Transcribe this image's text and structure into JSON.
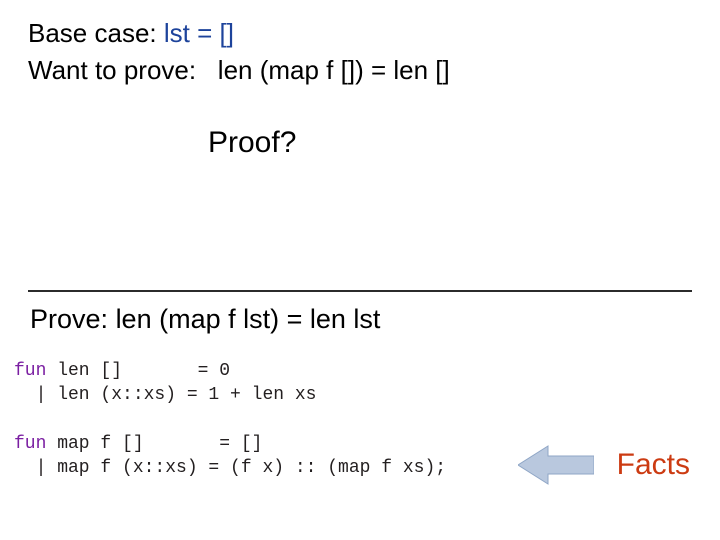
{
  "top": {
    "base_label": "Base case:",
    "base_eq": "lst = []",
    "want_label": "Want to prove:",
    "want_eq": "len (map f []) = len []"
  },
  "proof_label": "Proof?",
  "prove": {
    "label": "Prove:",
    "eq": "len (map f lst) = len lst"
  },
  "code": {
    "kw_fun": "fun",
    "len_line1": " len []       = 0",
    "len_line2": "  | len (x::xs) = 1 + len xs",
    "map_line1": " map f []       = []",
    "map_line2": "  | map f (x::xs) = (f x) :: (map f xs);"
  },
  "facts_label": "Facts"
}
